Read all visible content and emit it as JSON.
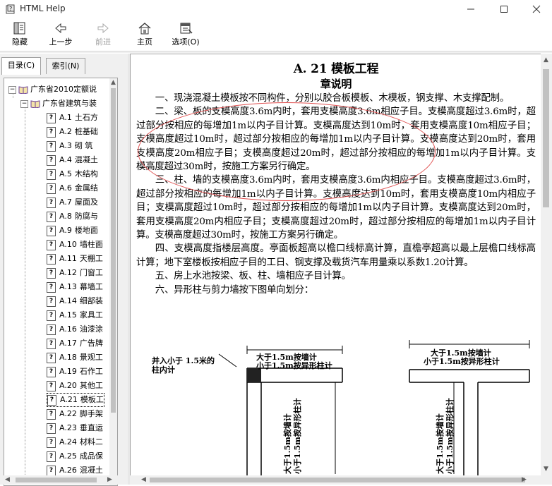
{
  "window": {
    "title": "HTML Help",
    "min_icon": "minimize-icon",
    "max_icon": "maximize-icon",
    "close_icon": "close-icon"
  },
  "toolbar": {
    "hide": "隐藏",
    "back": "上一步",
    "forward": "前进",
    "home": "主页",
    "options": "选项(O)"
  },
  "tabs": {
    "contents": "目录(C)",
    "index": "索引(N)"
  },
  "tree": {
    "root": "广东省2010定额说",
    "sub": "广东省建筑与装",
    "items": [
      {
        "code": "A.1",
        "name": "土石方"
      },
      {
        "code": "A.2",
        "name": "桩基础"
      },
      {
        "code": "A.3",
        "name": "砌  筑"
      },
      {
        "code": "A.4",
        "name": "混凝土"
      },
      {
        "code": "A.5",
        "name": "木结构"
      },
      {
        "code": "A.6",
        "name": "金属结"
      },
      {
        "code": "A.7",
        "name": "屋面及"
      },
      {
        "code": "A.8",
        "name": "防腐与"
      },
      {
        "code": "A.9",
        "name": "楼地面"
      },
      {
        "code": "A.10",
        "name": "墙柱面"
      },
      {
        "code": "A.11",
        "name": "天棚工"
      },
      {
        "code": "A.12",
        "name": "门窗工"
      },
      {
        "code": "A.13",
        "name": "幕墙工"
      },
      {
        "code": "A.14",
        "name": "细部装"
      },
      {
        "code": "A.15",
        "name": "家具工"
      },
      {
        "code": "A.16",
        "name": "油漆涂"
      },
      {
        "code": "A.17",
        "name": "广告牌"
      },
      {
        "code": "A.18",
        "name": "景观工"
      },
      {
        "code": "A.19",
        "name": "石作工"
      },
      {
        "code": "A.20",
        "name": "其他工"
      },
      {
        "code": "A.21",
        "name": "模板工"
      },
      {
        "code": "A.22",
        "name": "脚手架"
      },
      {
        "code": "A.23",
        "name": "垂直运"
      },
      {
        "code": "A.24",
        "name": "材料二"
      },
      {
        "code": "A.25",
        "name": "成品保"
      },
      {
        "code": "A.26",
        "name": "混凝土"
      }
    ],
    "selected_index": 20
  },
  "document": {
    "title": "A. 21   模板工程",
    "subtitle": "章说明",
    "paragraphs": [
      "一、现浇混凝土模板按不同构件，分别以胶合板模板、木模板，钢支撑、木支撑配制。",
      "二、梁、板的支模高度3.6m内时，套用支模高度3.6m相应子目。支模高度超过3.6m时，超过部分按相应的每增加1m以内子目计算。支模高度达到10m时，套用支模高度10m相应子目；支模高度超过10m时，超过部分按相应的每增加1m以内子目计算。支模高度达到20m时，套用支模高度20m相应子目；支模高度超过20m时，超过部分按相应的每增加1m以内子目计算。支模高度超过30m时，按施工方案另行确定。",
      "三、柱、墙的支模高度3.6m内时，套用支模高度3.6m内相应子目。支模高度超过3.6m时，超过部分按相应的每增加1m以内子目计算。支模高度达到10m时，套用支模高度10m内相应子目；支模高度超过10m时，超过部分按相应的每增加1m以内子目计算。支模高度达到20m时，套用支模高度20m内相应子目；支模高度超过20m时，超过部分按相应的每增加1m以内子目计算。支模高度超过30m时，按施工方案另行确定。",
      "四、支模高度指楼层高度。亭面板超高以檐口线标高计算，直檐亭超高以最上层檐口线标高计算；地下室楼板按相应子目的工日、钢支撑及载货汽车用量乘以系数1.20计算。",
      "五、房上水池按梁、板、柱、墙相应子目计算。",
      "六、异形柱与剪力墙按下图单向划分："
    ],
    "diagram": {
      "left_note": "并入小于 1.5米的柱内计",
      "left_top_1": "大于1.5m按墙计",
      "left_top_2": "小于1.5m按异形柱计",
      "left_vert_1": "大于1.5m按墙计",
      "left_vert_2": "小于1.5m按异形柱计",
      "right_top_1": "大于1.5m按墙计",
      "right_top_2": "小于1.5m按异形柱计",
      "right_vert_1": "大于1.5m按墙计",
      "right_vert_2": "小于1.5m按异形柱计"
    }
  }
}
